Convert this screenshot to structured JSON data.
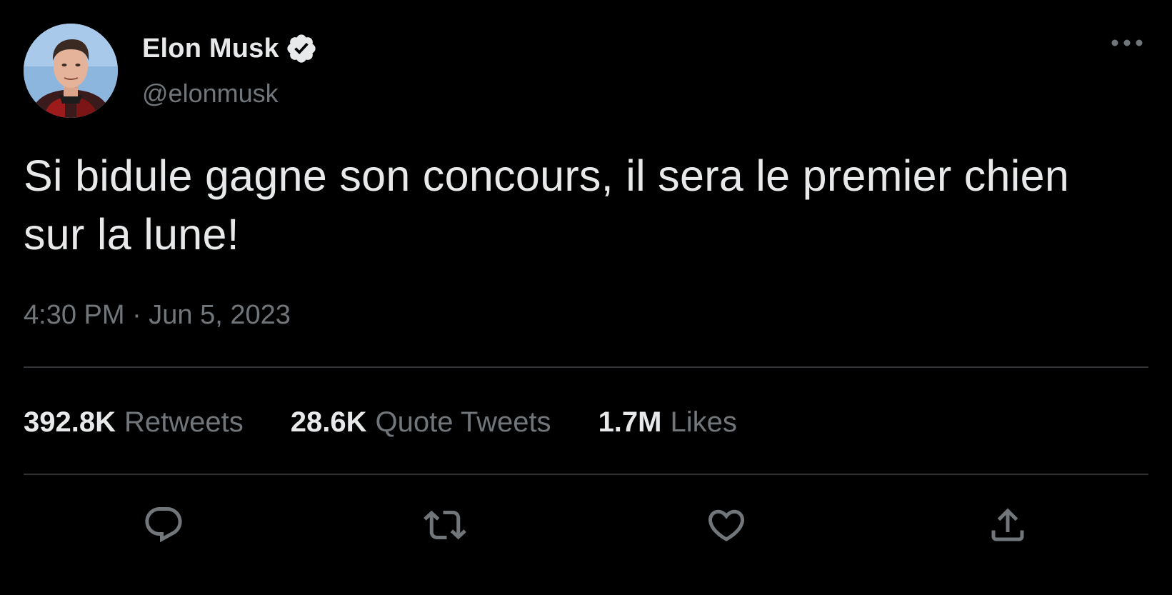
{
  "user": {
    "display_name": "Elon Musk",
    "handle": "@elonmusk",
    "verified": true,
    "verified_icon": "verified-badge-icon",
    "avatar": "profile-photo"
  },
  "tweet": {
    "text": "Si bidule gagne son concours, il sera le premier chien sur la lune!",
    "timestamp": "4:30 PM · Jun 5, 2023"
  },
  "stats": {
    "retweets_count": "392.8K",
    "retweets_label": "Retweets",
    "quotes_count": "28.6K",
    "quotes_label": "Quote Tweets",
    "likes_count": "1.7M",
    "likes_label": "Likes"
  },
  "actions": {
    "reply_icon": "reply-icon",
    "retweet_icon": "retweet-icon",
    "like_icon": "heart-icon",
    "share_icon": "share-icon",
    "more_icon": "more-icon"
  },
  "colors": {
    "background": "#000000",
    "primary_text": "#e7e9ea",
    "secondary_text": "#71767b",
    "divider": "#2f3336"
  }
}
